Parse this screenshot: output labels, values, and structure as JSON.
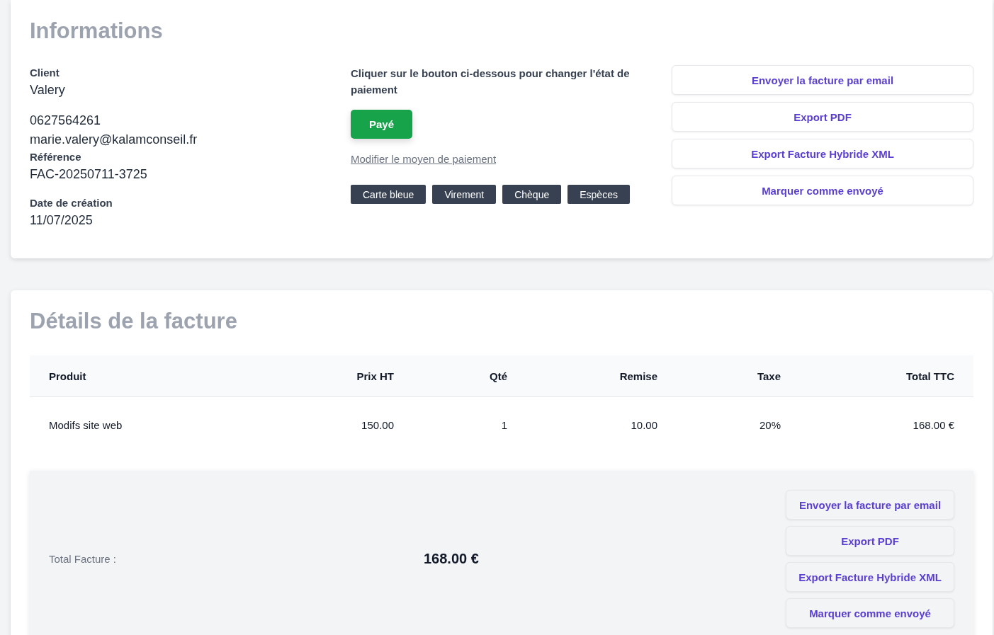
{
  "info": {
    "title": "Informations",
    "client_label": "Client",
    "client_name": "Valery",
    "phone": "0627564261",
    "email": "marie.valery@kalamconseil.fr",
    "reference_label": "Référence",
    "reference": "FAC-20250711-3725",
    "date_label": "Date de création",
    "date": "11/07/2025",
    "payment_hint": "Cliquer sur le bouton ci-dessous pour changer l'état de paiement",
    "payment_status": {
      "label": "Payé",
      "paid": true
    },
    "change_method_link": "Modifier le moyen de paiement",
    "methods": [
      "Carte bleue",
      "Virement",
      "Chèque",
      "Espèces"
    ],
    "actions": [
      "Envoyer la facture par email",
      "Export PDF",
      "Export Facture Hybride XML",
      "Marquer comme envoyé"
    ]
  },
  "details": {
    "title": "Détails de la facture",
    "table": {
      "columns": [
        "Produit",
        "Prix HT",
        "Qté",
        "Remise",
        "Taxe",
        "Total TTC"
      ],
      "rows": [
        [
          "Modifs site web",
          "150.00",
          "1",
          "10.00",
          "20%",
          "168.00 €"
        ]
      ]
    },
    "total_label": "Total Facture :",
    "total": "168.00 €",
    "actions": [
      "Envoyer la facture par email",
      "Export PDF",
      "Export Facture Hybride XML",
      "Marquer comme envoyé"
    ]
  }
}
